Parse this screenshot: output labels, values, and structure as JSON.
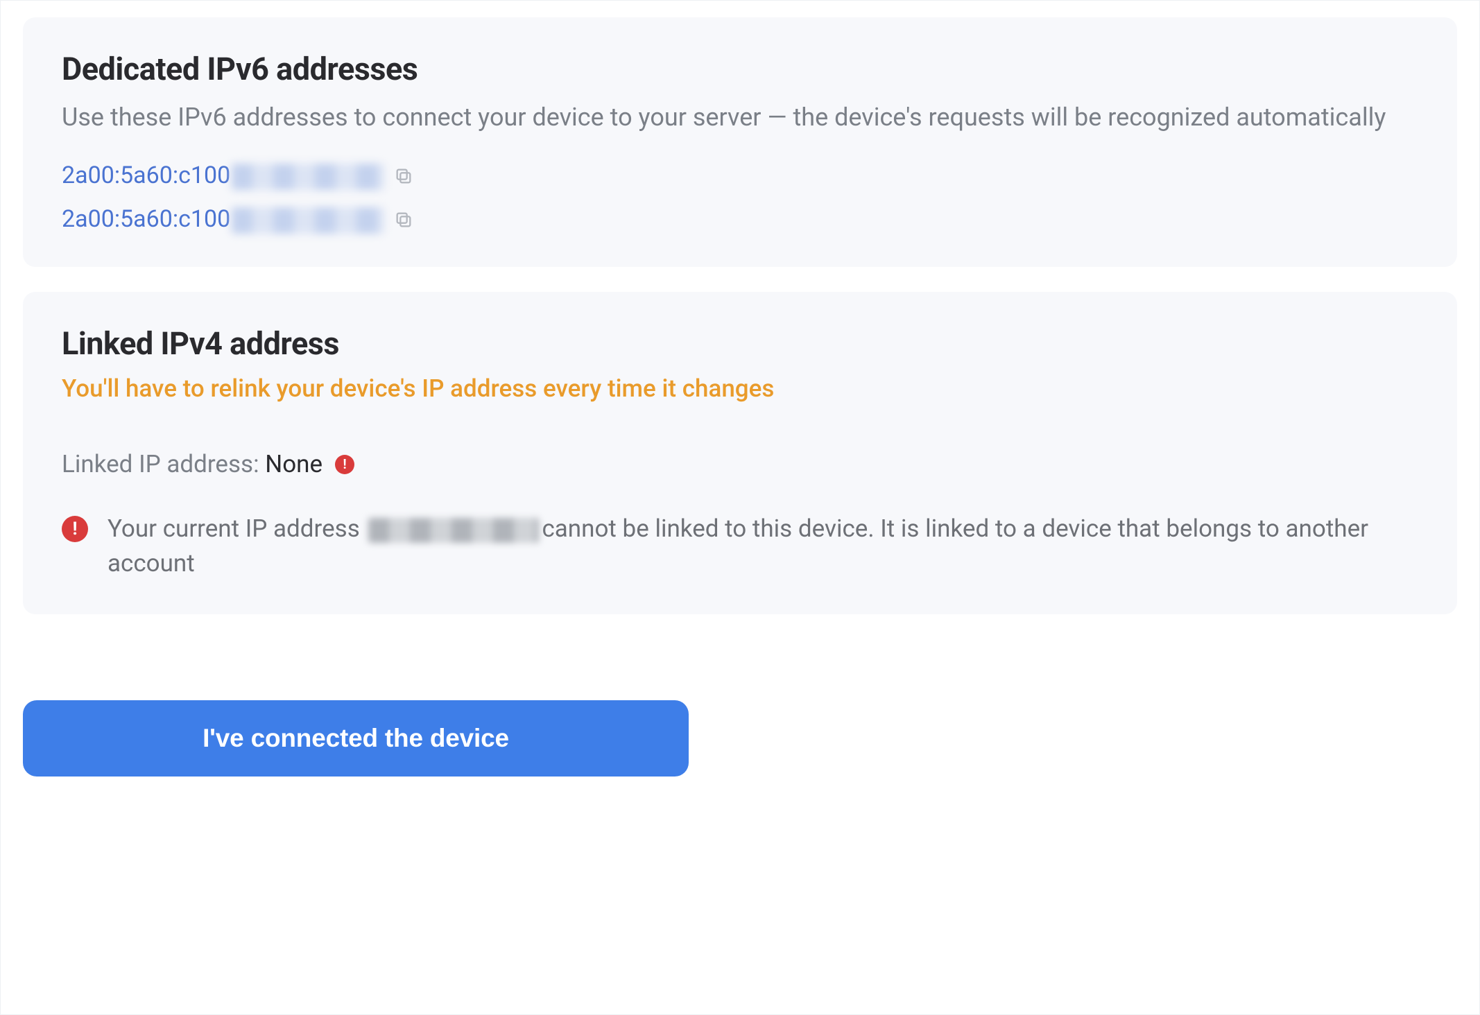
{
  "ipv6_section": {
    "heading": "Dedicated IPv6 addresses",
    "description": "Use these IPv6 addresses to connect your device to your server — the device's requests will be recognized automatically",
    "addresses": [
      {
        "visible_prefix": "2a00:5a60:c100"
      },
      {
        "visible_prefix": "2a00:5a60:c100"
      }
    ]
  },
  "ipv4_section": {
    "heading": "Linked IPv4 address",
    "warning": "You'll have to relink your device's IP address every time it changes",
    "linked_label": "Linked IP address: ",
    "linked_value": "None",
    "error_prefix": "Your current IP address ",
    "error_suffix": "cannot be linked to this device. It is linked to a device that belongs to another account"
  },
  "cta": {
    "label": "I've connected the device"
  }
}
